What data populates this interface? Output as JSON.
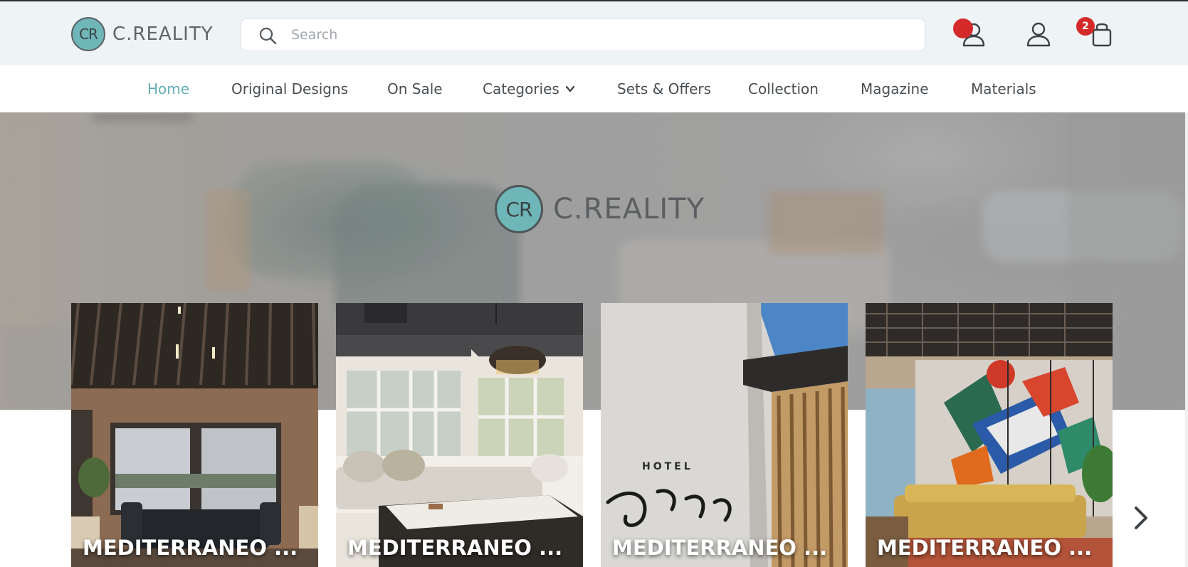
{
  "brand": {
    "logo_mark": "CR",
    "logo_text": "C.REALITY"
  },
  "search": {
    "placeholder": "Search",
    "icon": "search-icon"
  },
  "header_icons": {
    "notifications": {
      "icon": "user-notification-icon",
      "badge_color": "#d42a2a"
    },
    "account": {
      "icon": "user-icon"
    },
    "cart": {
      "icon": "shopping-bag-icon",
      "count": "2"
    }
  },
  "nav": {
    "items": [
      {
        "label": "Home",
        "active": true
      },
      {
        "label": "Original Designs"
      },
      {
        "label": "On Sale"
      },
      {
        "label": "Categories",
        "has_dropdown": true
      },
      {
        "label": "Sets & Offers"
      },
      {
        "label": "Collection"
      },
      {
        "label": "Magazine"
      },
      {
        "label": "Materials"
      }
    ]
  },
  "hero": {
    "logo_mark": "CR",
    "logo_text": "C.REALITY"
  },
  "cards": [
    {
      "title": "MEDITERRANEO ..."
    },
    {
      "title": "MEDITERRANEO ..."
    },
    {
      "title": "MEDITERRANEO ..."
    },
    {
      "title": "MEDITERRANEO ..."
    }
  ],
  "carousel": {
    "next_icon": "chevron-right-icon"
  },
  "colors": {
    "accent": "#64aeb6",
    "header_bg": "#eef3f6",
    "badge": "#d42a2a",
    "logo_teal": "#6fb6b8"
  }
}
